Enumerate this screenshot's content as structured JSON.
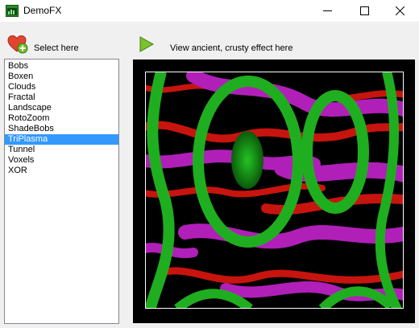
{
  "window": {
    "title": "DemoFX",
    "icons": {
      "app": "app-window-icon",
      "minimize": "minimize-icon",
      "maximize": "maximize-icon",
      "close": "close-icon"
    }
  },
  "toolbar": {
    "select_label": "Select here",
    "select_icon": "heart-add-icon",
    "view_label": "View ancient, crusty effect here",
    "view_icon": "play-icon"
  },
  "effects": {
    "items": [
      "Bobs",
      "Boxen",
      "Clouds",
      "Fractal",
      "Landscape",
      "RotoZoom",
      "ShadeBobs",
      "TriPlasma",
      "Tunnel",
      "Voxels",
      "XOR"
    ],
    "selected": "TriPlasma"
  },
  "colors": {
    "selection": "#3399ff",
    "plasma_green": "#1fae1f",
    "plasma_magenta": "#b01fb8",
    "plasma_red": "#c8140e"
  }
}
